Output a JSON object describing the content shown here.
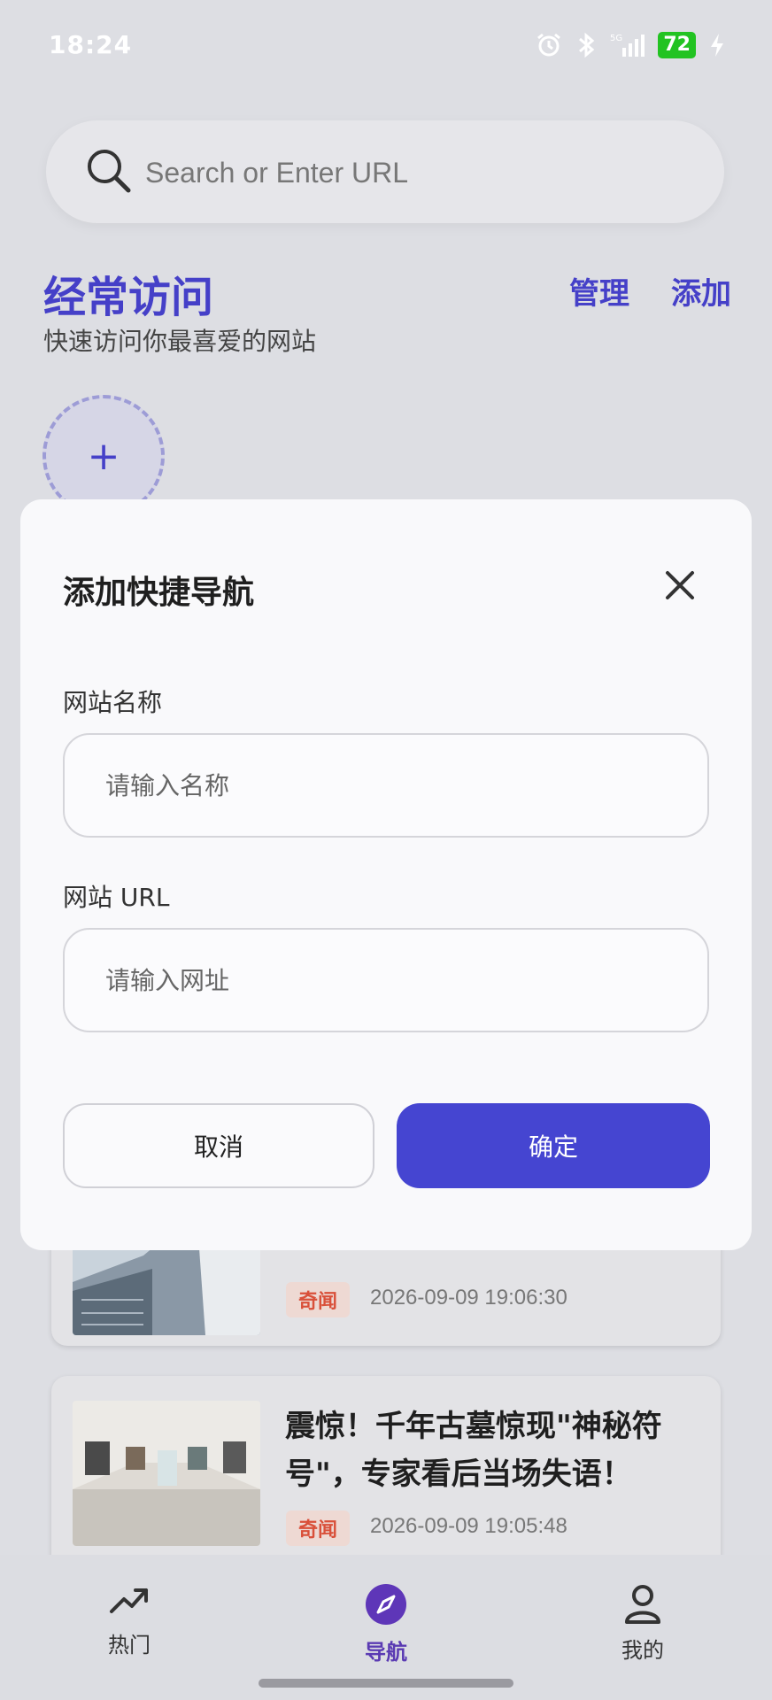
{
  "status": {
    "time": "18:24",
    "battery": "72",
    "signal": "5G"
  },
  "search": {
    "placeholder": "Search or Enter URL"
  },
  "frequent": {
    "title": "经常访问",
    "subtitle": "快速访问你最喜爱的网站",
    "manage_label": "管理",
    "add_label": "添加",
    "add_tile": "+"
  },
  "news": [
    {
      "title": "",
      "tag": "奇闻",
      "time": "2026-09-09 19:06:30"
    },
    {
      "title": "震惊！千年古墓惊现\"神秘符号\"，专家看后当场失语！",
      "tag": "奇闻",
      "time": "2026-09-09 19:05:48"
    }
  ],
  "dialog": {
    "title": "添加快捷导航",
    "name_label": "网站名称",
    "name_placeholder": "请输入名称",
    "url_label": "网站 URL",
    "url_placeholder": "请输入网址",
    "cancel_label": "取消",
    "confirm_label": "确定"
  },
  "nav": {
    "hot": "热门",
    "guide": "导航",
    "me": "我的"
  },
  "colors": {
    "accent": "#4540c8",
    "confirm": "#4545d1",
    "tag_text": "#d9503a",
    "battery": "#22c322"
  }
}
